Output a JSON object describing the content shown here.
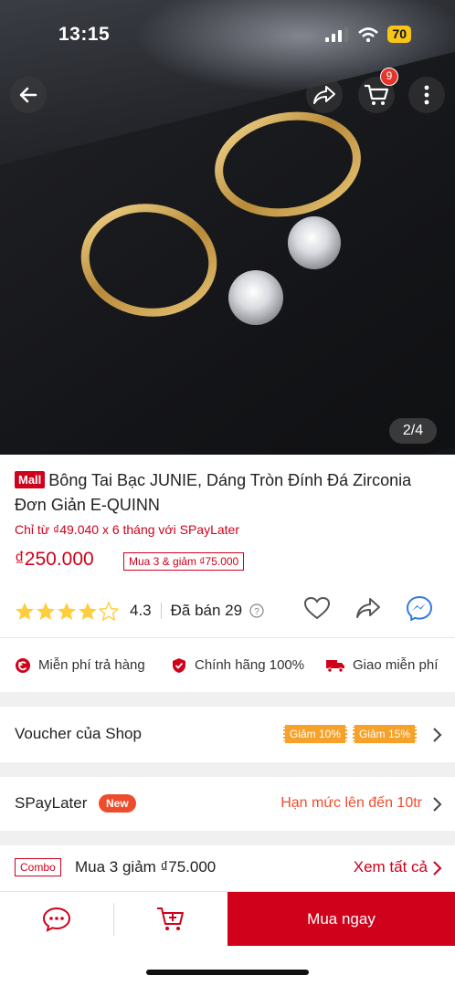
{
  "status": {
    "time": "13:15",
    "battery": "70"
  },
  "hero": {
    "counter": "2/4",
    "cart_count": "9"
  },
  "product": {
    "mall_label": "Mall",
    "title": "Bông Tai Bạc JUNIE, Dáng Tròn Đính Đá Zirconia Đơn Giản E-QUINN",
    "installment": "Chỉ từ ₫49.040 x 6 tháng với SPayLater",
    "price": "₫250.000",
    "bundle_tag": "Mua 3 & giảm ₫75.000",
    "rating": "4.3",
    "rating_fraction": 0.86,
    "sold": "Đã bán 29"
  },
  "assurances": [
    {
      "label": "Miễn phí trả hàng",
      "icon": "return-icon"
    },
    {
      "label": "Chính hãng 100%",
      "icon": "shield-check-icon"
    },
    {
      "label": "Giao miễn phí",
      "icon": "truck-icon"
    }
  ],
  "voucher": {
    "label": "Voucher của Shop",
    "chips": [
      "Giảm 10%",
      "Giảm 15%"
    ]
  },
  "spaylater": {
    "label": "SPayLater",
    "badge": "New",
    "limit": "Hạn mức lên đến 10tr"
  },
  "combo": {
    "tag": "Combo",
    "text": "Mua 3 giảm ₫75.000",
    "see_all": "Xem tất cả"
  },
  "bottom": {
    "buy_now": "Mua ngay"
  },
  "colors": {
    "primary": "#d0011b",
    "orange": "#ee4d2d",
    "voucher": "#f6a22a",
    "star": "#ffce3d"
  }
}
